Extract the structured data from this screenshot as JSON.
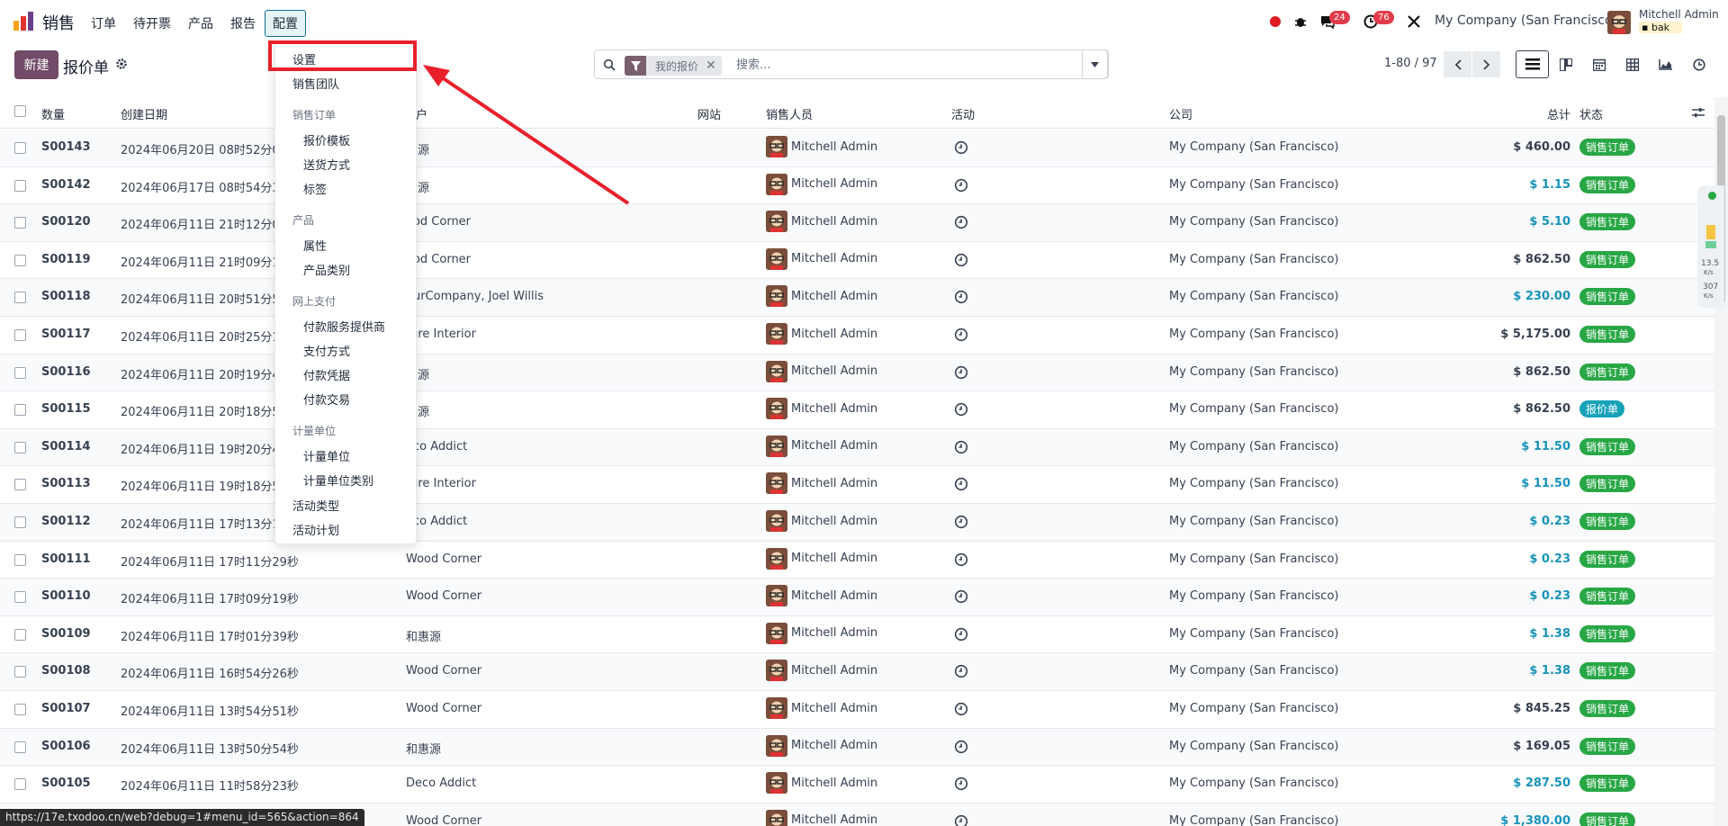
{
  "navbar": {
    "app_name": "销售",
    "menu": [
      "订单",
      "待开票",
      "产品",
      "报告",
      "配置"
    ],
    "active_menu": "配置",
    "messages_badge": "24",
    "activities_badge": "76",
    "company": "My Company (San Francisco)",
    "user_name": "Mitchell Admin",
    "user_db": "bak"
  },
  "control_panel": {
    "new_label": "新建",
    "breadcrumb": "报价单",
    "search_facet": "我的报价",
    "search_placeholder": "搜索...",
    "pager": "1-80 / 97"
  },
  "table": {
    "headers": {
      "number": "数量",
      "created": "创建日期",
      "customer": "户",
      "website": "网站",
      "salesperson": "销售人员",
      "activity": "活动",
      "company": "公司",
      "total": "总计",
      "status": "状态"
    },
    "rows": [
      {
        "number": "S00143",
        "created": "2024年06月20日 08时52分0",
        "customer": "惠源",
        "salesperson": "Mitchell Admin",
        "company": "My Company (San Francisco)",
        "total": "$ 460.00",
        "total_style": "plain",
        "status": "销售订单"
      },
      {
        "number": "S00142",
        "created": "2024年06月17日 08时54分3",
        "customer": "惠源",
        "salesperson": "Mitchell Admin",
        "company": "My Company (San Francisco)",
        "total": "$ 1.15",
        "total_style": "blue",
        "status": "销售订单"
      },
      {
        "number": "S00120",
        "created": "2024年06月11日 21时12分0",
        "customer": "ood Corner",
        "salesperson": "Mitchell Admin",
        "company": "My Company (San Francisco)",
        "total": "$ 5.10",
        "total_style": "blue",
        "status": "销售订单"
      },
      {
        "number": "S00119",
        "created": "2024年06月11日 21时09分1",
        "customer": "ood Corner",
        "salesperson": "Mitchell Admin",
        "company": "My Company (San Francisco)",
        "total": "$ 862.50",
        "total_style": "plain",
        "status": "销售订单"
      },
      {
        "number": "S00118",
        "created": "2024年06月11日 20时51分5",
        "customer": "ourCompany, Joel Willis",
        "salesperson": "Mitchell Admin",
        "company": "My Company (San Francisco)",
        "total": "$ 230.00",
        "total_style": "blue",
        "status": "销售订单"
      },
      {
        "number": "S00117",
        "created": "2024年06月11日 20时25分1",
        "customer": "ture Interior",
        "salesperson": "Mitchell Admin",
        "company": "My Company (San Francisco)",
        "total": "$ 5,175.00",
        "total_style": "plain",
        "status": "销售订单"
      },
      {
        "number": "S00116",
        "created": "2024年06月11日 20时19分4",
        "customer": "惠源",
        "salesperson": "Mitchell Admin",
        "company": "My Company (San Francisco)",
        "total": "$ 862.50",
        "total_style": "plain",
        "status": "销售订单"
      },
      {
        "number": "S00115",
        "created": "2024年06月11日 20时18分5",
        "customer": "惠源",
        "salesperson": "Mitchell Admin",
        "company": "My Company (San Francisco)",
        "total": "$ 862.50",
        "total_style": "plain",
        "status": "报价单"
      },
      {
        "number": "S00114",
        "created": "2024年06月11日 19时20分4",
        "customer": "eco Addict",
        "salesperson": "Mitchell Admin",
        "company": "My Company (San Francisco)",
        "total": "$ 11.50",
        "total_style": "blue",
        "status": "销售订单"
      },
      {
        "number": "S00113",
        "created": "2024年06月11日 19时18分5",
        "customer": "ture Interior",
        "salesperson": "Mitchell Admin",
        "company": "My Company (San Francisco)",
        "total": "$ 11.50",
        "total_style": "blue",
        "status": "销售订单"
      },
      {
        "number": "S00112",
        "created": "2024年06月11日 17时13分1",
        "customer": "eco Addict",
        "salesperson": "Mitchell Admin",
        "company": "My Company (San Francisco)",
        "total": "$ 0.23",
        "total_style": "blue",
        "status": "销售订单"
      },
      {
        "number": "S00111",
        "created": "2024年06月11日 17时11分29秒",
        "customer": "Wood Corner",
        "salesperson": "Mitchell Admin",
        "company": "My Company (San Francisco)",
        "total": "$ 0.23",
        "total_style": "blue",
        "status": "销售订单"
      },
      {
        "number": "S00110",
        "created": "2024年06月11日 17时09分19秒",
        "customer": "Wood Corner",
        "salesperson": "Mitchell Admin",
        "company": "My Company (San Francisco)",
        "total": "$ 0.23",
        "total_style": "blue",
        "status": "销售订单"
      },
      {
        "number": "S00109",
        "created": "2024年06月11日 17时01分39秒",
        "customer": "和惠源",
        "salesperson": "Mitchell Admin",
        "company": "My Company (San Francisco)",
        "total": "$ 1.38",
        "total_style": "blue",
        "status": "销售订单"
      },
      {
        "number": "S00108",
        "created": "2024年06月11日 16时54分26秒",
        "customer": "Wood Corner",
        "salesperson": "Mitchell Admin",
        "company": "My Company (San Francisco)",
        "total": "$ 1.38",
        "total_style": "blue",
        "status": "销售订单"
      },
      {
        "number": "S00107",
        "created": "2024年06月11日 13时54分51秒",
        "customer": "Wood Corner",
        "salesperson": "Mitchell Admin",
        "company": "My Company (San Francisco)",
        "total": "$ 845.25",
        "total_style": "plain",
        "status": "销售订单"
      },
      {
        "number": "S00106",
        "created": "2024年06月11日 13时50分54秒",
        "customer": "和惠源",
        "salesperson": "Mitchell Admin",
        "company": "My Company (San Francisco)",
        "total": "$ 169.05",
        "total_style": "plain",
        "status": "销售订单"
      },
      {
        "number": "S00105",
        "created": "2024年06月11日 11时58分23秒",
        "customer": "Deco Addict",
        "salesperson": "Mitchell Admin",
        "company": "My Company (San Francisco)",
        "total": "$ 287.50",
        "total_style": "blue",
        "status": "销售订单"
      },
      {
        "number": "",
        "created": "",
        "customer": "Wood Corner",
        "salesperson": "Mitchell Admin",
        "company": "My Company (San Francisco)",
        "total": "$ 1,380.00",
        "total_style": "blue",
        "status": "销售订单"
      }
    ]
  },
  "dropdown": {
    "items": [
      {
        "type": "item",
        "label": "设置",
        "indent": 0
      },
      {
        "type": "item",
        "label": "销售团队",
        "indent": 0
      },
      {
        "type": "header",
        "label": "销售订单"
      },
      {
        "type": "item",
        "label": "报价模板",
        "indent": 1
      },
      {
        "type": "item",
        "label": "送货方式",
        "indent": 1
      },
      {
        "type": "item",
        "label": "标签",
        "indent": 1
      },
      {
        "type": "header",
        "label": "产品"
      },
      {
        "type": "item",
        "label": "属性",
        "indent": 1
      },
      {
        "type": "item",
        "label": "产品类别",
        "indent": 1
      },
      {
        "type": "header",
        "label": "网上支付"
      },
      {
        "type": "item",
        "label": "付款服务提供商",
        "indent": 1
      },
      {
        "type": "item",
        "label": "支付方式",
        "indent": 1
      },
      {
        "type": "item",
        "label": "付款凭据",
        "indent": 1
      },
      {
        "type": "item",
        "label": "付款交易",
        "indent": 1
      },
      {
        "type": "header",
        "label": "计量单位"
      },
      {
        "type": "item",
        "label": "计量单位",
        "indent": 1
      },
      {
        "type": "item",
        "label": "计量单位类别",
        "indent": 1
      },
      {
        "type": "item",
        "label": "活动类型",
        "indent": 0
      },
      {
        "type": "item",
        "label": "活动计划",
        "indent": 0
      }
    ]
  },
  "speed_widget": {
    "upload": "13.5",
    "download": "307",
    "unit": "K/s"
  },
  "status_url": "https://17e.txodoo.cn/web?debug=1#menu_id=565&action=864",
  "colors": {
    "primary": "#714b67",
    "badge_sale": "#28a745",
    "badge_quote": "#17a2b8",
    "annotation": "#e8202b",
    "total_blue": "#1793b8"
  }
}
